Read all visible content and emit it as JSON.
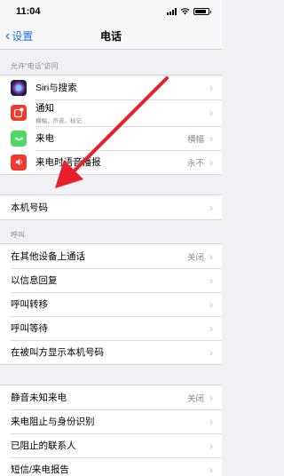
{
  "status_bar": {
    "time": "11:04"
  },
  "nav": {
    "back_label": "设置",
    "title": "电话"
  },
  "section_allow": {
    "header": "允许“电话”访问",
    "items": [
      {
        "label": "Siri与搜索",
        "icon": "siri-icon",
        "icon_color": "#2b2b5e"
      },
      {
        "label": "通知",
        "sublabel": "横幅，声音，标记",
        "icon": "notification-icon",
        "icon_color": "#f03a30"
      },
      {
        "label": "来电",
        "value": "横幅",
        "icon": "phone-icon",
        "icon_color": "#4cd964"
      },
      {
        "label": "来电时语音播报",
        "value": "永不",
        "icon": "speaker-icon",
        "icon_color": "#f03a30"
      }
    ]
  },
  "section_number": {
    "items": [
      {
        "label": "本机号码"
      }
    ]
  },
  "section_calls": {
    "header": "呼叫",
    "items": [
      {
        "label": "在其他设备上通话",
        "value": "关闭"
      },
      {
        "label": "以信息回复"
      },
      {
        "label": "呼叫转移"
      },
      {
        "label": "呼叫等待"
      },
      {
        "label": "在被叫方显示本机号码"
      }
    ]
  },
  "section_silence": {
    "items": [
      {
        "label": "静音未知来电",
        "value": "关闭"
      },
      {
        "label": "来电阻止与身份识别"
      },
      {
        "label": "已阻止的联系人"
      },
      {
        "label": "短信/来电报告"
      }
    ]
  },
  "colors": {
    "accent": "#1a73e8",
    "annotation_arrow": "#e8202a"
  }
}
